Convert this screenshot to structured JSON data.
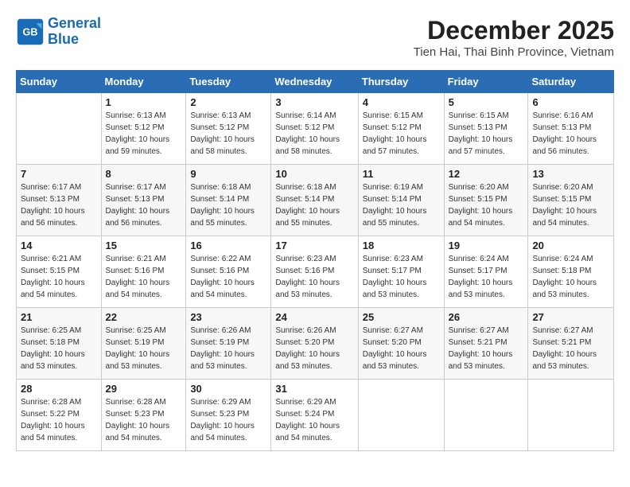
{
  "logo": {
    "line1": "General",
    "line2": "Blue"
  },
  "header": {
    "month": "December 2025",
    "location": "Tien Hai, Thai Binh Province, Vietnam"
  },
  "weekdays": [
    "Sunday",
    "Monday",
    "Tuesday",
    "Wednesday",
    "Thursday",
    "Friday",
    "Saturday"
  ],
  "weeks": [
    [
      {
        "day": "",
        "sunrise": "",
        "sunset": "",
        "daylight": ""
      },
      {
        "day": "1",
        "sunrise": "Sunrise: 6:13 AM",
        "sunset": "Sunset: 5:12 PM",
        "daylight": "Daylight: 10 hours and 59 minutes."
      },
      {
        "day": "2",
        "sunrise": "Sunrise: 6:13 AM",
        "sunset": "Sunset: 5:12 PM",
        "daylight": "Daylight: 10 hours and 58 minutes."
      },
      {
        "day": "3",
        "sunrise": "Sunrise: 6:14 AM",
        "sunset": "Sunset: 5:12 PM",
        "daylight": "Daylight: 10 hours and 58 minutes."
      },
      {
        "day": "4",
        "sunrise": "Sunrise: 6:15 AM",
        "sunset": "Sunset: 5:12 PM",
        "daylight": "Daylight: 10 hours and 57 minutes."
      },
      {
        "day": "5",
        "sunrise": "Sunrise: 6:15 AM",
        "sunset": "Sunset: 5:13 PM",
        "daylight": "Daylight: 10 hours and 57 minutes."
      },
      {
        "day": "6",
        "sunrise": "Sunrise: 6:16 AM",
        "sunset": "Sunset: 5:13 PM",
        "daylight": "Daylight: 10 hours and 56 minutes."
      }
    ],
    [
      {
        "day": "7",
        "sunrise": "Sunrise: 6:17 AM",
        "sunset": "Sunset: 5:13 PM",
        "daylight": "Daylight: 10 hours and 56 minutes."
      },
      {
        "day": "8",
        "sunrise": "Sunrise: 6:17 AM",
        "sunset": "Sunset: 5:13 PM",
        "daylight": "Daylight: 10 hours and 56 minutes."
      },
      {
        "day": "9",
        "sunrise": "Sunrise: 6:18 AM",
        "sunset": "Sunset: 5:14 PM",
        "daylight": "Daylight: 10 hours and 55 minutes."
      },
      {
        "day": "10",
        "sunrise": "Sunrise: 6:18 AM",
        "sunset": "Sunset: 5:14 PM",
        "daylight": "Daylight: 10 hours and 55 minutes."
      },
      {
        "day": "11",
        "sunrise": "Sunrise: 6:19 AM",
        "sunset": "Sunset: 5:14 PM",
        "daylight": "Daylight: 10 hours and 55 minutes."
      },
      {
        "day": "12",
        "sunrise": "Sunrise: 6:20 AM",
        "sunset": "Sunset: 5:15 PM",
        "daylight": "Daylight: 10 hours and 54 minutes."
      },
      {
        "day": "13",
        "sunrise": "Sunrise: 6:20 AM",
        "sunset": "Sunset: 5:15 PM",
        "daylight": "Daylight: 10 hours and 54 minutes."
      }
    ],
    [
      {
        "day": "14",
        "sunrise": "Sunrise: 6:21 AM",
        "sunset": "Sunset: 5:15 PM",
        "daylight": "Daylight: 10 hours and 54 minutes."
      },
      {
        "day": "15",
        "sunrise": "Sunrise: 6:21 AM",
        "sunset": "Sunset: 5:16 PM",
        "daylight": "Daylight: 10 hours and 54 minutes."
      },
      {
        "day": "16",
        "sunrise": "Sunrise: 6:22 AM",
        "sunset": "Sunset: 5:16 PM",
        "daylight": "Daylight: 10 hours and 54 minutes."
      },
      {
        "day": "17",
        "sunrise": "Sunrise: 6:23 AM",
        "sunset": "Sunset: 5:16 PM",
        "daylight": "Daylight: 10 hours and 53 minutes."
      },
      {
        "day": "18",
        "sunrise": "Sunrise: 6:23 AM",
        "sunset": "Sunset: 5:17 PM",
        "daylight": "Daylight: 10 hours and 53 minutes."
      },
      {
        "day": "19",
        "sunrise": "Sunrise: 6:24 AM",
        "sunset": "Sunset: 5:17 PM",
        "daylight": "Daylight: 10 hours and 53 minutes."
      },
      {
        "day": "20",
        "sunrise": "Sunrise: 6:24 AM",
        "sunset": "Sunset: 5:18 PM",
        "daylight": "Daylight: 10 hours and 53 minutes."
      }
    ],
    [
      {
        "day": "21",
        "sunrise": "Sunrise: 6:25 AM",
        "sunset": "Sunset: 5:18 PM",
        "daylight": "Daylight: 10 hours and 53 minutes."
      },
      {
        "day": "22",
        "sunrise": "Sunrise: 6:25 AM",
        "sunset": "Sunset: 5:19 PM",
        "daylight": "Daylight: 10 hours and 53 minutes."
      },
      {
        "day": "23",
        "sunrise": "Sunrise: 6:26 AM",
        "sunset": "Sunset: 5:19 PM",
        "daylight": "Daylight: 10 hours and 53 minutes."
      },
      {
        "day": "24",
        "sunrise": "Sunrise: 6:26 AM",
        "sunset": "Sunset: 5:20 PM",
        "daylight": "Daylight: 10 hours and 53 minutes."
      },
      {
        "day": "25",
        "sunrise": "Sunrise: 6:27 AM",
        "sunset": "Sunset: 5:20 PM",
        "daylight": "Daylight: 10 hours and 53 minutes."
      },
      {
        "day": "26",
        "sunrise": "Sunrise: 6:27 AM",
        "sunset": "Sunset: 5:21 PM",
        "daylight": "Daylight: 10 hours and 53 minutes."
      },
      {
        "day": "27",
        "sunrise": "Sunrise: 6:27 AM",
        "sunset": "Sunset: 5:21 PM",
        "daylight": "Daylight: 10 hours and 53 minutes."
      }
    ],
    [
      {
        "day": "28",
        "sunrise": "Sunrise: 6:28 AM",
        "sunset": "Sunset: 5:22 PM",
        "daylight": "Daylight: 10 hours and 54 minutes."
      },
      {
        "day": "29",
        "sunrise": "Sunrise: 6:28 AM",
        "sunset": "Sunset: 5:23 PM",
        "daylight": "Daylight: 10 hours and 54 minutes."
      },
      {
        "day": "30",
        "sunrise": "Sunrise: 6:29 AM",
        "sunset": "Sunset: 5:23 PM",
        "daylight": "Daylight: 10 hours and 54 minutes."
      },
      {
        "day": "31",
        "sunrise": "Sunrise: 6:29 AM",
        "sunset": "Sunset: 5:24 PM",
        "daylight": "Daylight: 10 hours and 54 minutes."
      },
      {
        "day": "",
        "sunrise": "",
        "sunset": "",
        "daylight": ""
      },
      {
        "day": "",
        "sunrise": "",
        "sunset": "",
        "daylight": ""
      },
      {
        "day": "",
        "sunrise": "",
        "sunset": "",
        "daylight": ""
      }
    ]
  ]
}
